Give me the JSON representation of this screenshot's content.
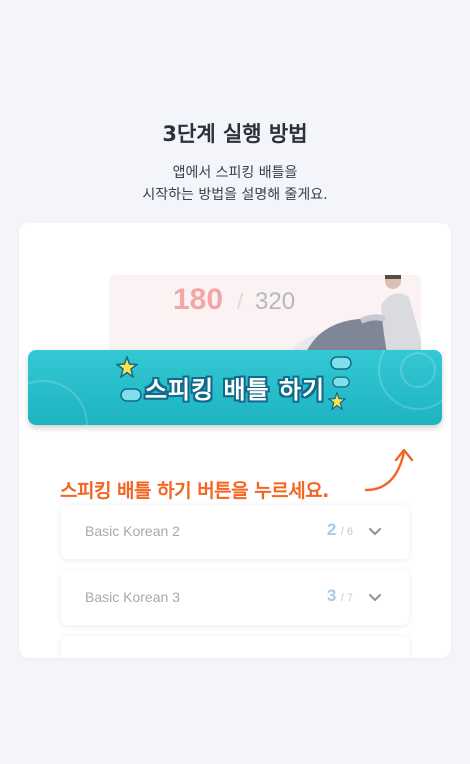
{
  "title": "3단계 실행 방법",
  "description": [
    "앱에서 스피킹 배틀을",
    "시작하는 방법을 설명해 줄게요."
  ],
  "hero": {
    "score": "180",
    "separator": "/",
    "total": "320"
  },
  "battle_button": {
    "label": "스피킹 배틀 하기"
  },
  "hint": "스피킹 배틀 하기 버튼을 누르세요.",
  "rows": [
    {
      "label": "Basic Korean 2",
      "count": "2",
      "total": "/ 6"
    },
    {
      "label": "Basic Korean 3",
      "count": "3",
      "total": "/ 7"
    }
  ],
  "colors": {
    "accent": "#f26522",
    "button": "#1eb3c1",
    "background": "#f3f5fa"
  },
  "icons": [
    "chevron-down-icon",
    "sparkle-star-icon",
    "curved-arrow-icon"
  ]
}
